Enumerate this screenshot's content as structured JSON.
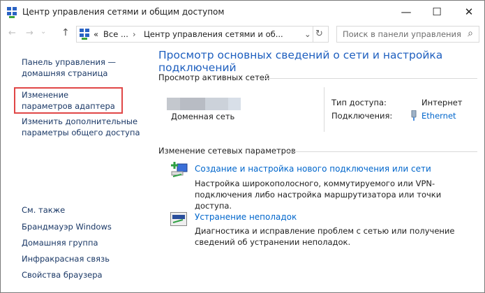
{
  "window": {
    "title": "Центр управления сетями и общим доступом",
    "minimize": "—",
    "maximize": "☐",
    "close": "✕"
  },
  "nav": {
    "back": "←",
    "forward": "→",
    "recent": "⌄",
    "up": "↑",
    "breadcrumb_prefix": "«",
    "crumb1": "Все ...",
    "sep": "›",
    "crumb2": "Центр управления сетями и об...",
    "dropdown": "⌄",
    "refresh": "↻",
    "search_placeholder": "Поиск в панели управления",
    "search_icon": "⌕"
  },
  "sidebar": {
    "home": "Панель управления — домашняя страница",
    "items": [
      "Изменение параметров адаптера",
      "Изменить дополнительные параметры общего доступа"
    ],
    "see_also": "См. также",
    "see_also_items": [
      "Брандмауэр Windows",
      "Домашняя группа",
      "Инфракрасная связь",
      "Свойства браузера"
    ],
    "highlight_color": "#e04646"
  },
  "main": {
    "title": "Просмотр основных сведений о сети и настройка подключений",
    "active_networks": "Просмотр активных сетей",
    "network_type": "Доменная сеть",
    "access_label": "Тип доступа:",
    "access_value": "Интернет",
    "connections_label": "Подключения:",
    "connections_value": "Ethernet",
    "change_settings": "Изменение сетевых параметров",
    "tasks": [
      {
        "title": "Создание и настройка нового подключения или сети",
        "desc": "Настройка широкополосного, коммутируемого или VPN-подключения либо настройка маршрутизатора или точки доступа."
      },
      {
        "title": "Устранение неполадок",
        "desc": "Диагностика и исправление проблем с сетью или получение сведений об устранении неполадок."
      }
    ]
  }
}
